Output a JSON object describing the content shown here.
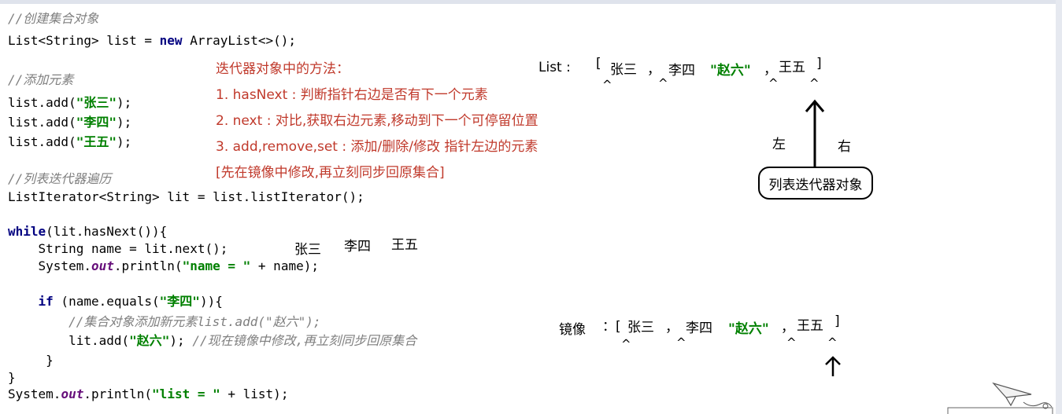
{
  "code": {
    "comment_create": "//创建集合对象",
    "create_prefix": "List<String> list = ",
    "create_new": "new",
    "create_suffix": " ArrayList<>();",
    "comment_add": "//添加元素",
    "add_prefix": "list.add(",
    "add_suffix": ");",
    "str_zhangsan": "\"张三\"",
    "str_lisi": "\"李四\"",
    "str_wangwu": "\"王五\"",
    "comment_iter": "//列表迭代器遍历",
    "iter_line": "ListIterator<String> lit = list.listIterator();",
    "while_kw": "while",
    "while_rest": "(lit.hasNext()){",
    "name_line": "    String name = lit.next();",
    "sysout_prefix": "    System.",
    "out_field": "out",
    "println_open": ".println(",
    "str_name_eq": "\"name = \"",
    "println_name_rest": " + name);",
    "if_indent": "    ",
    "if_kw": "if",
    "if_mid": " (name.equals(",
    "str_lisi2": "\"李四\"",
    "if_end": ")){",
    "inner_comment": "        //集合对象添加新元素list.add(\"赵六\");",
    "inner_add_prefix": "        lit.add(",
    "str_zhaoliu": "\"赵六\"",
    "inner_add_suffix": "); ",
    "inner_add_comment": "//现在镜像中修改,再立刻同步回原集合",
    "close_inner": "     }",
    "close_outer": "}",
    "sysout2_prefix": "System.",
    "out_field2": "out",
    "println_open2": ".println(",
    "str_list_eq": "\"list = \"",
    "println_list_rest": " + list);"
  },
  "notes": {
    "title": "迭代器对象中的方法：",
    "item1": "1. hasNext : 判断指针右边是否有下一个元素",
    "item2": "2. next : 对比,获取右边元素,移动到下一个可停留位置",
    "item3": "3. add,remove,set : 添加/删除/修改 指针左边的元素",
    "item4": "[先在镜像中修改,再立刻同步回原集合]"
  },
  "output_names": {
    "a": "张三",
    "b": "李四",
    "c": "王五"
  },
  "list_diagram": {
    "label": "List :",
    "open": "[",
    "e1": "张三",
    "sep1": "，",
    "e2": "李四",
    "e3": "\"赵六\"",
    "sep2": "，",
    "e4": "王五",
    "close": "]",
    "caret": "^",
    "left": "左",
    "right": "右",
    "iterator_label": "列表迭代器对象"
  },
  "mirror_diagram": {
    "label": "镜像",
    "open": "：[",
    "e1": "张三",
    "sep1": "，",
    "e2": "李四",
    "e3": "\"赵六\"",
    "sep2": "，",
    "e4": "王五",
    "close": "]",
    "caret": "^"
  },
  "colors": {
    "comment": "#7f7f7f",
    "keyword": "#000080",
    "string": "#008000",
    "note": "#c0392b"
  }
}
